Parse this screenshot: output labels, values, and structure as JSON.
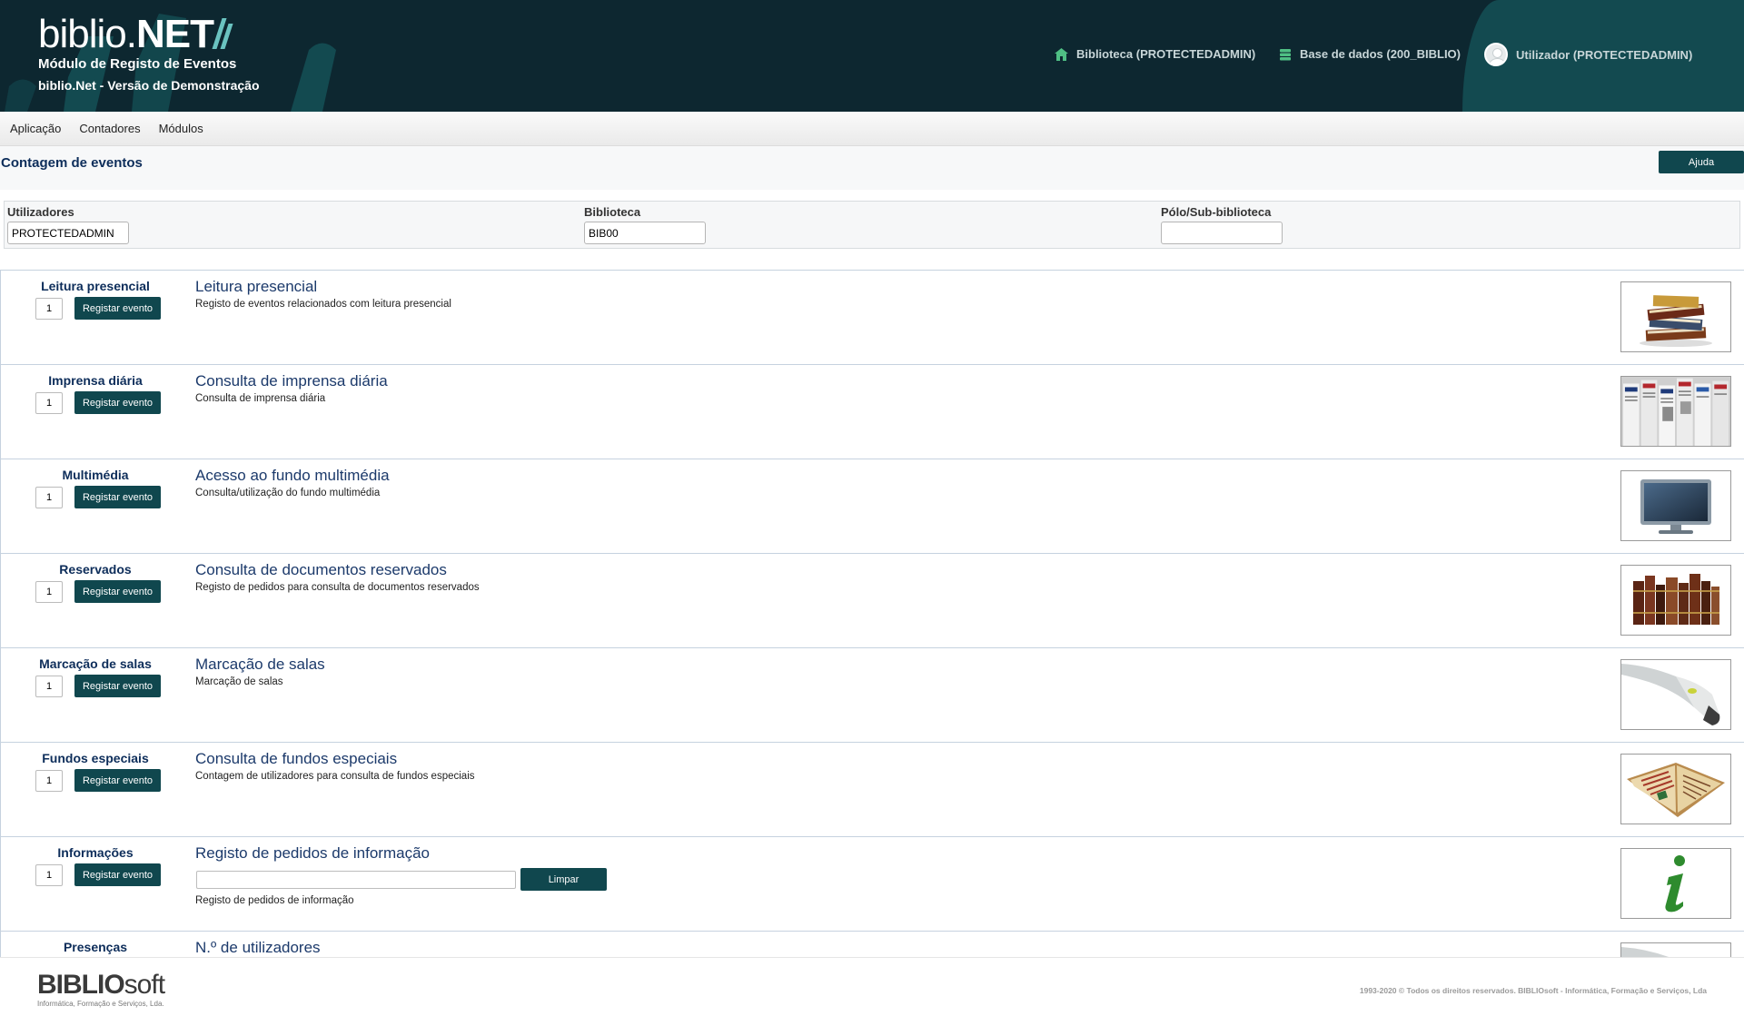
{
  "header": {
    "logo_light": "biblio.",
    "logo_bold": "NET",
    "subtitle": "Módulo de Registo de Eventos",
    "version": "biblio.Net - Versão de Demonstração",
    "library": "Biblioteca (PROTECTEDADMIN)",
    "database": "Base de dados (200_BIBLIO)",
    "user": "Utilizador (PROTECTEDADMIN)"
  },
  "menu": {
    "items": [
      {
        "label": "Aplicação"
      },
      {
        "label": "Contadores"
      },
      {
        "label": "Módulos"
      }
    ]
  },
  "page": {
    "title": "Contagem de eventos",
    "help_label": "Ajuda"
  },
  "filters": {
    "users_label": "Utilizadores",
    "users_value": "PROTECTEDADMIN",
    "library_label": "Biblioteca",
    "library_value": "BIB00",
    "branch_label": "Pólo/Sub-biblioteca",
    "branch_value": ""
  },
  "events": [
    {
      "title": "Leitura presencial",
      "qty": "1",
      "button": "Registar evento",
      "name": "Leitura presencial",
      "description": "Registo de eventos relacionados com leitura presencial",
      "icon": "books-stack-icon"
    },
    {
      "title": "Imprensa diária",
      "qty": "1",
      "button": "Registar evento",
      "name": "Consulta de imprensa diária",
      "description": "Consulta de imprensa diária",
      "icon": "newspapers-icon"
    },
    {
      "title": "Multimédia",
      "qty": "1",
      "button": "Registar evento",
      "name": "Acesso ao fundo multimédia",
      "description": "Consulta/utilização do fundo multimédia",
      "icon": "tv-monitor-icon"
    },
    {
      "title": "Reservados",
      "qty": "1",
      "button": "Registar evento",
      "name": "Consulta de documentos reservados",
      "description": "Registo de pedidos para consulta de documentos reservados",
      "icon": "old-books-icon"
    },
    {
      "title": "Marcação de salas",
      "qty": "1",
      "button": "Registar evento",
      "name": "Marcação de salas",
      "description": "Marcação de salas",
      "icon": "barcode-scanner-icon"
    },
    {
      "title": "Fundos especiais",
      "qty": "1",
      "button": "Registar evento",
      "name": "Consulta de fundos especiais",
      "description": "Contagem de utilizadores para consulta de fundos especiais",
      "icon": "manuscript-icon"
    },
    {
      "title": "Informações",
      "qty": "1",
      "button": "Registar evento",
      "name": "Registo de pedidos de informação",
      "description": "Registo de pedidos de informação",
      "icon": "info-icon",
      "clear_label": "Limpar"
    },
    {
      "title": "Presenças",
      "name": "N.º de utilizadores",
      "icon": "barcode-scanner-icon"
    }
  ],
  "footer": {
    "logo_part1": "BIBLIO",
    "logo_part2": "soft",
    "tagline": "Informática, Formação e Serviços, Lda.",
    "copyright": "1993-2020 © Todos os direitos reservados. BIBLIOsoft - Informática, Formação e Serviços, Lda"
  },
  "colors": {
    "header_bg": "#0d2730",
    "accent": "#10474e",
    "title_blue": "#0d2d5a"
  }
}
